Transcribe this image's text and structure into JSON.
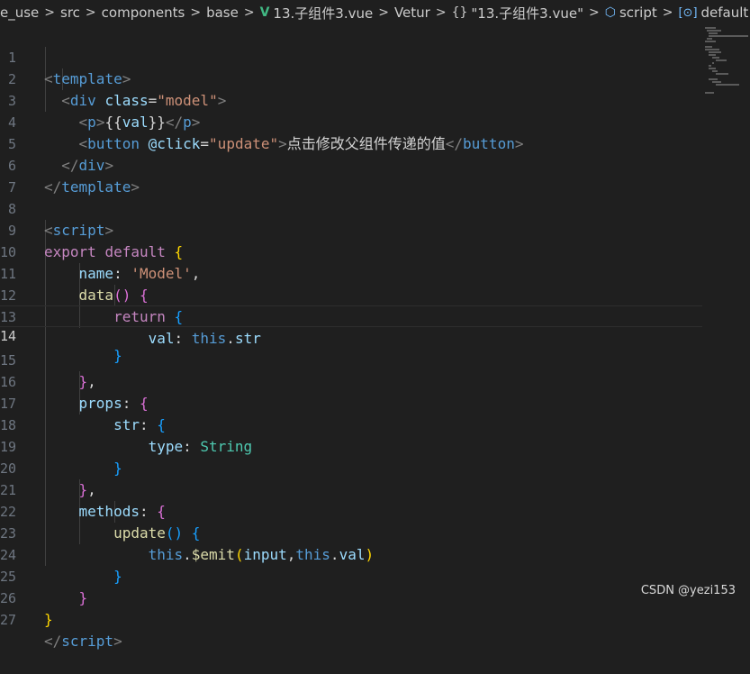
{
  "breadcrumb": {
    "items": [
      "e_use",
      "src",
      "components",
      "base"
    ],
    "file": "13.子组件3.vue",
    "vetur": "Vetur",
    "object": "\"13.子组件3.vue\"",
    "script": "script",
    "default": "default"
  },
  "line_numbers": [
    "1",
    "2",
    "3",
    "4",
    "5",
    "6",
    "7",
    "8",
    "9",
    "10",
    "11",
    "12",
    "13",
    "14",
    "15",
    "16",
    "17",
    "18",
    "19",
    "20",
    "21",
    "22",
    "23",
    "24",
    "25",
    "26",
    "27"
  ],
  "code": {
    "l1_tag": "template",
    "l2_tag": "div",
    "l2_attr": "class",
    "l2_val": "\"model\"",
    "l3_tag": "p",
    "l3_expr": "val",
    "l4_tag": "button",
    "l4_attr": "@click",
    "l4_val": "\"update\"",
    "l4_text": "点击修改父组件传递的值",
    "l5_tag": "div",
    "l6_tag": "template",
    "l8_tag": "script",
    "l9_export": "export",
    "l9_default": "default",
    "l10_key": "name",
    "l10_val": "'Model'",
    "l11_fn": "data",
    "l12_return": "return",
    "l13_key": "val",
    "l13_this": "this",
    "l13_prop": "str",
    "l16_key": "props",
    "l17_key": "str",
    "l18_key": "type",
    "l18_val": "String",
    "l21_key": "methods",
    "l22_fn": "update",
    "l23_this": "this",
    "l23_fn": "$emit",
    "l23_arg": "input",
    "l23_this2": "this",
    "l23_prop": "val",
    "l27_tag": "script"
  },
  "watermark": "CSDN @yezi153"
}
